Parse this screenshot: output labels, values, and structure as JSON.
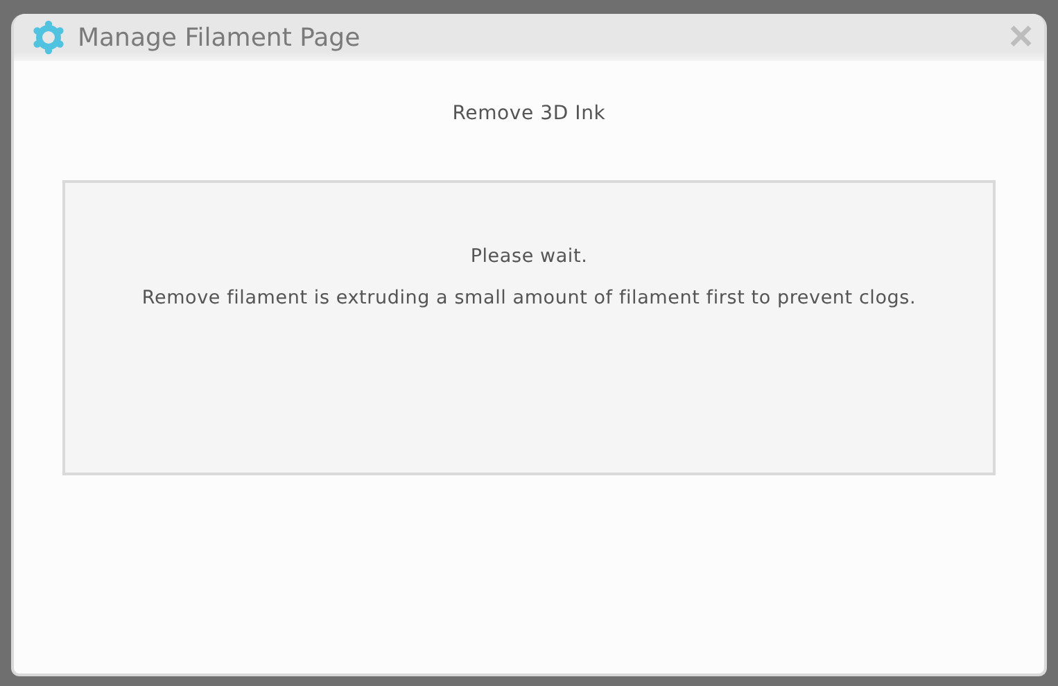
{
  "window": {
    "title": "Manage Filament Page",
    "close": "×"
  },
  "heading": "Remove 3D Ink",
  "message": {
    "lines": [
      "Please wait.",
      "Remove filament is extruding a small amount of filament first to prevent clogs."
    ]
  }
}
